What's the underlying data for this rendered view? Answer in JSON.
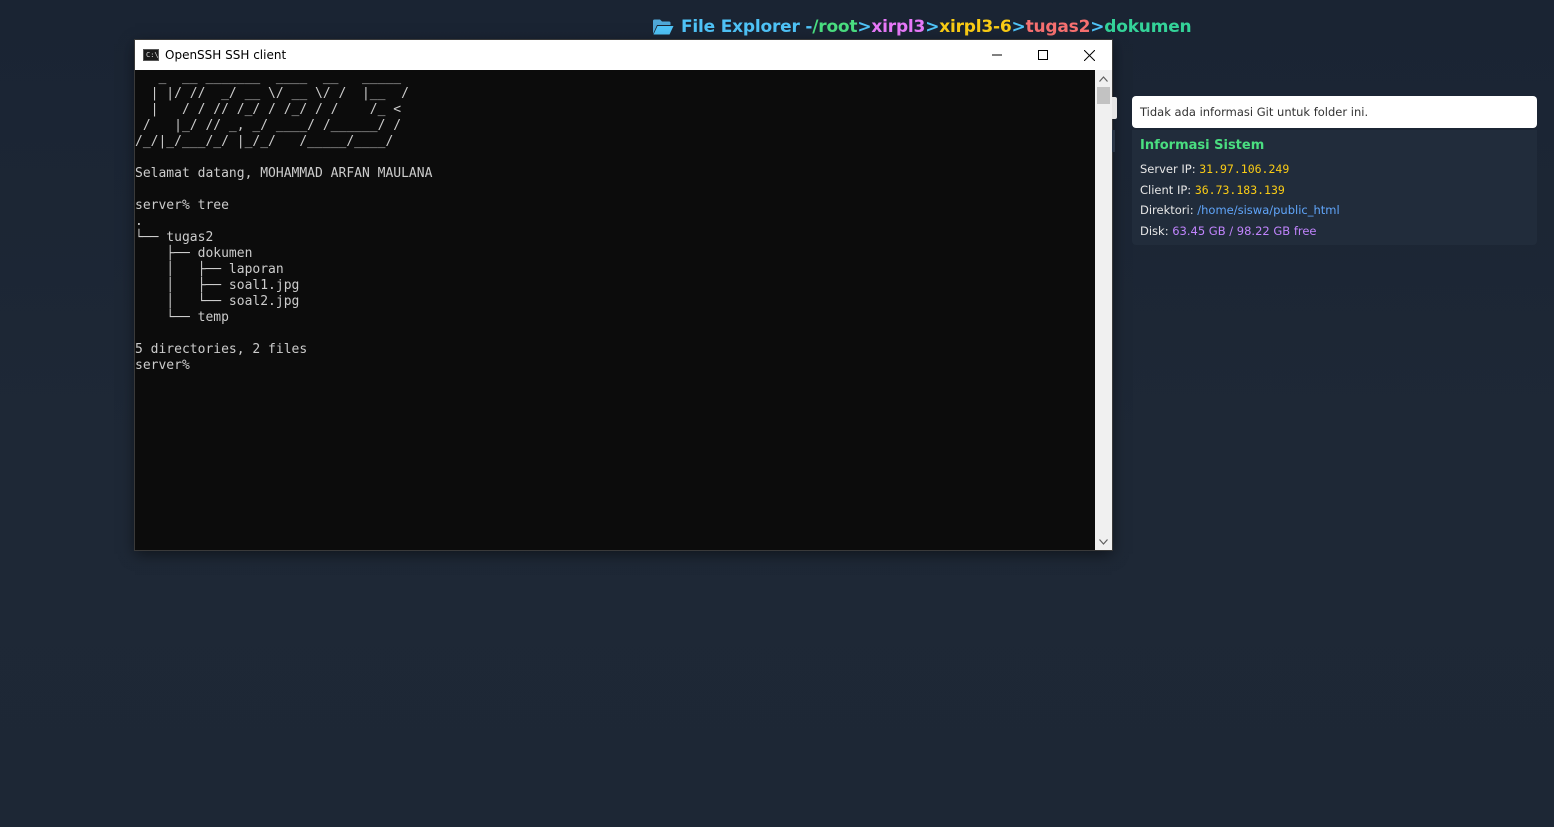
{
  "header": {
    "folder_icon": "folder-open-icon",
    "title": "File Explorer - ",
    "separator": ">",
    "path": [
      {
        "label": "/root",
        "color": "#4ade80"
      },
      {
        "label": "xirpl3",
        "color": "#e879f9"
      },
      {
        "label": "xirpl3-6",
        "color": "#facc15"
      },
      {
        "label": "tugas2",
        "color": "#f87171"
      },
      {
        "label": "dokumen",
        "color": "#34d399"
      }
    ],
    "title_color": "#4fc3f7"
  },
  "window": {
    "title": "OpenSSH SSH client",
    "app_icon_text": "C:\\",
    "minimize_icon": "minimize-icon",
    "maximize_icon": "maximize-icon",
    "close_icon": "close-icon"
  },
  "terminal": {
    "lines": [
      "   _  __ _______  ____  __   _____",
      "  | |/ //  _/ __ \\/ __ \\/ /  |__  /",
      "  |   / / // /_/ / /_/ / /    /_ <",
      " /   |_/ // _, _/ ____/ /______/ /",
      "/_/|_/___/_/ |_/_/   /_____/____/",
      "",
      "Selamat datang, MOHAMMAD ARFAN MAULANA",
      "",
      "server% tree",
      ".",
      "└── tugas2",
      "    ├── dokumen",
      "    │   ├── laporan",
      "    │   ├── soal1.jpg",
      "    │   └── soal2.jpg",
      "    └── temp",
      "",
      "5 directories, 2 files",
      "server%"
    ]
  },
  "git": {
    "message": "Tidak ada informasi Git untuk folder ini."
  },
  "system": {
    "heading": "Informasi Sistem",
    "server_ip_label": "Server IP: ",
    "server_ip": "31.97.106.249",
    "client_ip_label": "Client IP: ",
    "client_ip": "36.73.183.139",
    "directory_label": "Direktori: ",
    "directory": "/home/siswa/public_html",
    "disk_label": "Disk: ",
    "disk": "63.45 GB / 98.22 GB free"
  }
}
